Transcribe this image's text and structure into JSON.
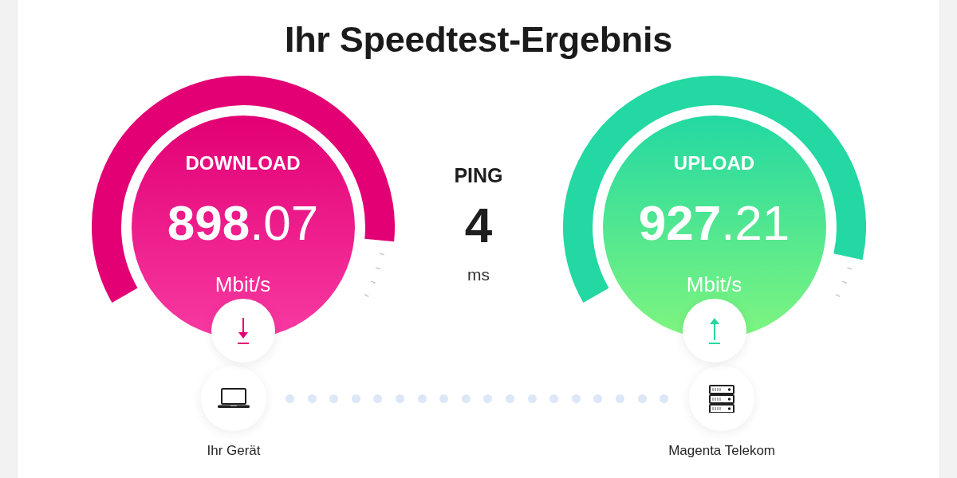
{
  "title": "Ihr Speedtest-Ergebnis",
  "metrics": [
    {
      "kind": "download",
      "label": "DOWNLOAD",
      "value": "**898**.07",
      "unit": "Mbit/s",
      "color": "#e20074"
    },
    {
      "kind": "ping",
      "label": "PING",
      "value": "4",
      "unit": "ms"
    },
    {
      "kind": "upload",
      "label": "UPLOAD",
      "value": "**927**.21",
      "unit": "Mbit/s",
      "color": "#23d8a2"
    }
  ],
  "endpoints": [
    {
      "kind": "laptop",
      "label": "Ihr Gerät"
    },
    {
      "kind": "server",
      "label": "Magenta Telekom"
    }
  ]
}
